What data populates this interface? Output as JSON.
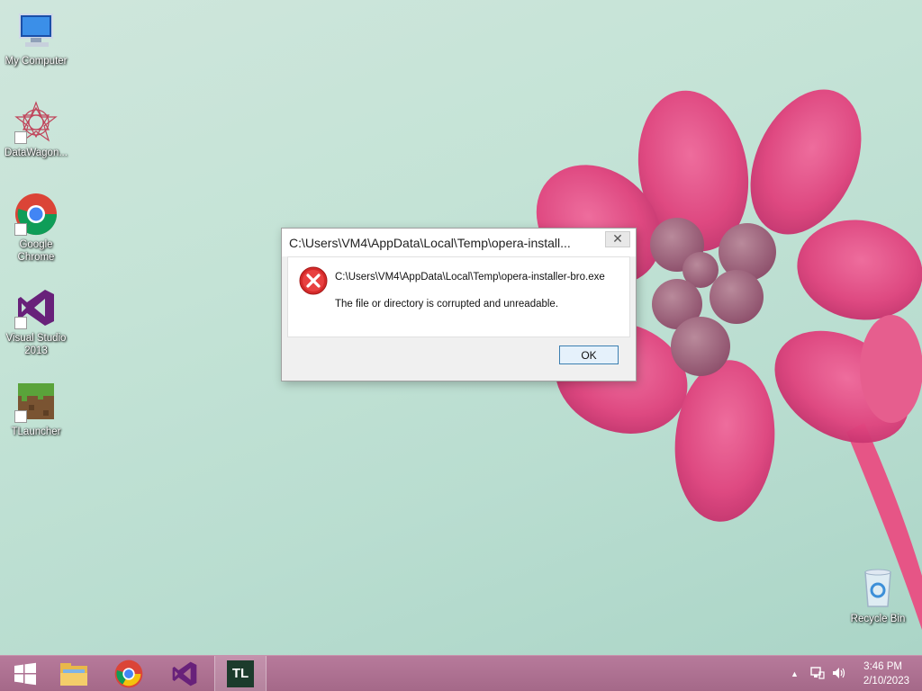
{
  "desktop": {
    "icons": [
      {
        "label": "My Computer",
        "icon": "computer-icon"
      },
      {
        "label": "DataWagon...",
        "icon": "datawagon-icon"
      },
      {
        "label": "Google\nChrome",
        "icon": "chrome-icon"
      },
      {
        "label": "Visual Studio\n2013",
        "icon": "visual-studio-icon"
      },
      {
        "label": "TLauncher",
        "icon": "tlauncher-icon"
      },
      {
        "label": "Recycle Bin",
        "icon": "recycle-bin-icon"
      }
    ]
  },
  "dialog": {
    "title": "C:\\Users\\VM4\\AppData\\Local\\Temp\\opera-install...",
    "close_label": "✕",
    "path": "C:\\Users\\VM4\\AppData\\Local\\Temp\\opera-installer-bro.exe",
    "message": "The file or directory is corrupted and unreadable.",
    "ok_label": "OK",
    "icon": "error-icon"
  },
  "taskbar": {
    "items": [
      {
        "name": "start",
        "icon": "windows-logo-icon"
      },
      {
        "name": "file-explorer",
        "icon": "folder-icon"
      },
      {
        "name": "chrome",
        "icon": "chrome-icon"
      },
      {
        "name": "visual-studio",
        "icon": "visual-studio-icon"
      },
      {
        "name": "tlauncher",
        "icon": "tlauncher-icon",
        "text": "TL",
        "active": true
      }
    ],
    "tray": {
      "time": "3:46 PM",
      "date": "2/10/2023"
    }
  },
  "colors": {
    "taskbar": "#a96d8e",
    "flower": "#e0457f",
    "error_red": "#d42a2a",
    "vs_purple": "#68217a"
  }
}
